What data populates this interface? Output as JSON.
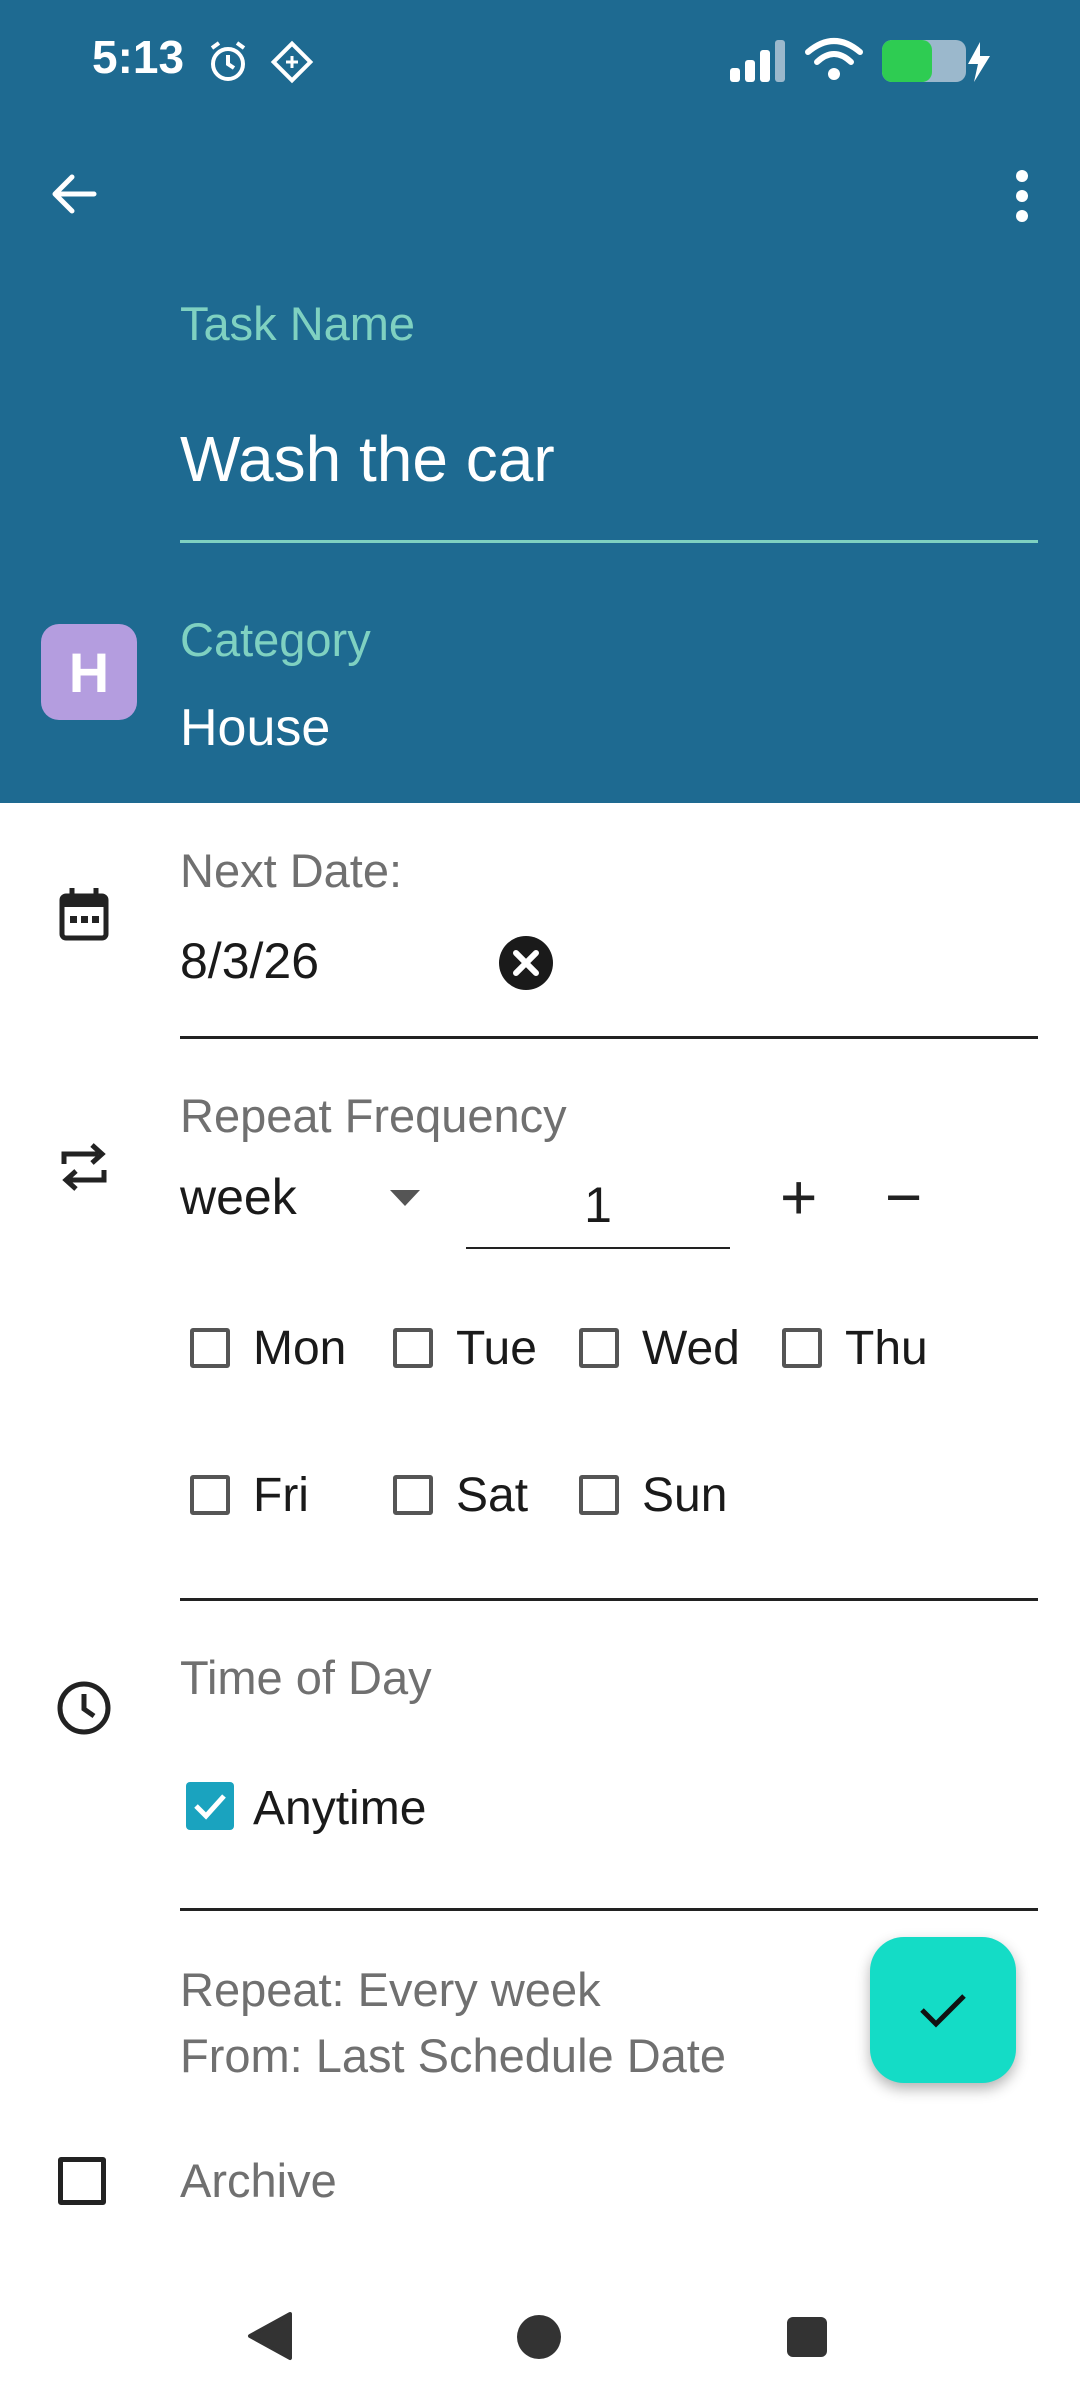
{
  "status_bar": {
    "time": "5:13",
    "battery_color": "#2ecc52"
  },
  "toolbar": {
    "back_icon": "arrow-left-icon",
    "menu_icon": "more-vert-icon"
  },
  "task": {
    "label": "Task Name",
    "value": "Wash the car"
  },
  "category": {
    "label": "Category",
    "value": "House",
    "badge_letter": "H",
    "badge_color": "#b49ddf"
  },
  "next_date": {
    "label": "Next Date:",
    "value": "8/3/26"
  },
  "repeat": {
    "label": "Repeat Frequency",
    "unit": "week",
    "count": "1",
    "plus": "+",
    "minus": "−",
    "days": [
      {
        "label": "Mon",
        "checked": false
      },
      {
        "label": "Tue",
        "checked": false
      },
      {
        "label": "Wed",
        "checked": false
      },
      {
        "label": "Thu",
        "checked": false
      },
      {
        "label": "Fri",
        "checked": false
      },
      {
        "label": "Sat",
        "checked": false
      },
      {
        "label": "Sun",
        "checked": false
      }
    ]
  },
  "time_of_day": {
    "label": "Time of Day",
    "option": "Anytime",
    "checked": true
  },
  "summary": {
    "line1": "Repeat: Every week",
    "line2": "From: Last Schedule Date"
  },
  "archive": {
    "label": "Archive",
    "checked": false
  },
  "colors": {
    "header": "#1e6a91",
    "accent": "#7fd1c1",
    "fab": "#14dcc6",
    "checkbox": "#1aa3bf"
  }
}
